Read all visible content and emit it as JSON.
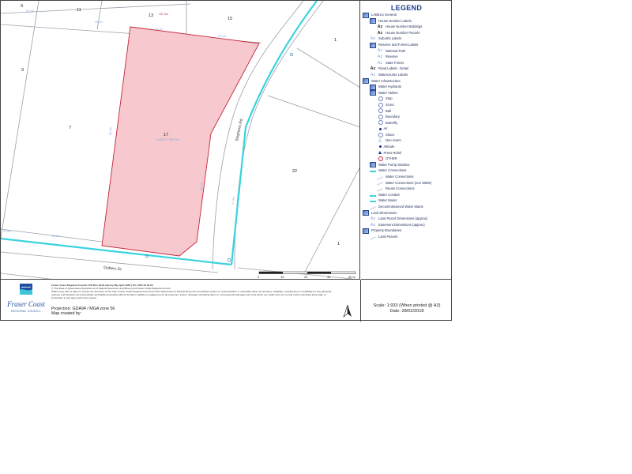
{
  "map": {
    "lot_labels": {
      "top_left": "9",
      "top_11": "11",
      "top_13": "13",
      "top_15": "15",
      "lot_9": "9",
      "lot_7": "7",
      "lot_17": "17",
      "lot_1_top": "1",
      "lot_22": "22",
      "lot_1_bottom": "1"
    },
    "selected_parcel_sublabel": "SUBJECT PARCEL",
    "dimension_labels": {
      "top_red": "137.0m",
      "top_a": "20.1m",
      "top_b": "20.1m",
      "top_c": "20.1m",
      "top_d": "20.1m",
      "left_a": "85.0m",
      "right_a": "40.2m",
      "bottom_a": "60.0m",
      "bottom_left": "25.0m",
      "road_side": "37.9m"
    },
    "road_names": {
      "stephens": "Stephens Rd",
      "gobers": "Gobers Dr"
    },
    "scale_bar": {
      "ticks": [
        "0",
        "10",
        "20",
        "30",
        "40 m"
      ]
    },
    "colors": {
      "water_main": "#39d3e0",
      "parcel_fill": "#f7c9cf",
      "parcel_stroke": "#c0263a",
      "boundary": "#9aa0aa"
    }
  },
  "legend": {
    "title": "LEGEND",
    "items": [
      {
        "label": "LABELS General",
        "symbol": "layer",
        "level": 0
      },
      {
        "label": "House Number Labels",
        "symbol": "layer",
        "level": 1
      },
      {
        "label": "House Number Buildings",
        "symbol": "az",
        "level": 2
      },
      {
        "label": "House Number Parcels",
        "symbol": "az",
        "level": 2
      },
      {
        "label": "Suburbs Labels",
        "symbol": "az-light",
        "level": 1
      },
      {
        "label": "Reserve and Forest Labels",
        "symbol": "layer",
        "level": 1
      },
      {
        "label": "National Park",
        "symbol": "az-light",
        "level": 2
      },
      {
        "label": "Reserve",
        "symbol": "az-light",
        "level": 2
      },
      {
        "label": "State Forest",
        "symbol": "az-light",
        "level": 2
      },
      {
        "label": "Road Labels - Detail",
        "symbol": "az",
        "level": 1
      },
      {
        "label": "Watercourse Labels",
        "symbol": "az-light",
        "level": 1
      },
      {
        "label": "Water Infrastructure",
        "symbol": "layer",
        "level": 0
      },
      {
        "label": "Water Hydrants",
        "symbol": "layer",
        "level": 1
      },
      {
        "label": "Water Valves",
        "symbol": "layer",
        "level": 1
      },
      {
        "label": "Stop",
        "symbol": "circle",
        "level": 2
      },
      {
        "label": "Scour",
        "symbol": "circle",
        "level": 2
      },
      {
        "label": "Ball",
        "symbol": "circle",
        "level": 2
      },
      {
        "label": "Boundary",
        "symbol": "circle",
        "level": 2
      },
      {
        "label": "Butterfly",
        "symbol": "circle",
        "level": 2
      },
      {
        "label": "Air",
        "symbol": "dot",
        "level": 2
      },
      {
        "label": "Sluice",
        "symbol": "circle",
        "level": 2
      },
      {
        "label": "Non return",
        "symbol": "tri-outline",
        "level": 2
      },
      {
        "label": "Altitude",
        "symbol": "dot",
        "level": 2
      },
      {
        "label": "Press Relief",
        "symbol": "tri",
        "level": 2
      },
      {
        "label": "OTHER",
        "symbol": "red-circle",
        "level": 2
      },
      {
        "label": "Water Pump Stations",
        "symbol": "layer",
        "level": 1
      },
      {
        "label": "Water Connections",
        "symbol": "line",
        "level": 1
      },
      {
        "label": "Water Connections",
        "symbol": "line-grey",
        "level": 2
      },
      {
        "label": "Water Connections (non WBW)",
        "symbol": "line-grey",
        "level": 2
      },
      {
        "label": "Reuse Connections",
        "symbol": "line-grey",
        "level": 2
      },
      {
        "label": "Water Conduit",
        "symbol": "line",
        "level": 1
      },
      {
        "label": "Water Mains",
        "symbol": "line",
        "level": 1
      },
      {
        "label": "Decommissioned Water Mains",
        "symbol": "line-grey",
        "level": 1
      },
      {
        "label": "Land Dimensions",
        "symbol": "layer",
        "level": 0
      },
      {
        "label": "Land Parcel Dimensions (approx)",
        "symbol": "az-light",
        "level": 1
      },
      {
        "label": "Easement Dimensions (approx)",
        "symbol": "az-light",
        "level": 1
      },
      {
        "label": "Property Boundaries",
        "symbol": "layer",
        "level": 0
      },
      {
        "label": "Land Parcels",
        "symbol": "line-grey",
        "level": 1
      }
    ]
  },
  "footer": {
    "logo_text": "Fraser Coast",
    "logo_subtext": "REGIONAL COUNCIL",
    "council_line": "Fraser Coast Regional Council | PO Box 1943, Hervey Bay QLD 4655 | Ph: 1300 79 49 29",
    "copyright_line": "© The State of Queensland (Department of Natural Resources and Mines) and Fraser Coast Regional Council",
    "disclaimer_1": "While every care is taken to ensure the accuracy of this map, Fraser Coast Regional Council and the Department of Natural Resources and Mines makes no representation or warranties about its accuracy, reliability, completeness or suitability for any particular",
    "disclaimer_2": "purpose and disclaims all responsibility and liability (including without limitation, liability in negligence) for all expenses, losses, damages (including direct or consequential damage) and costs which you might incur as a result of the map being inaccurate or",
    "disclaimer_3": "incomplete in any way and for any reason.",
    "projection": "Projection: GDA94 / MGA zone 56",
    "map_created_by": "Map created by:",
    "scale": "Scale: 1:933 (When printed @ A3)",
    "date": "Date:  28/02/2018"
  }
}
